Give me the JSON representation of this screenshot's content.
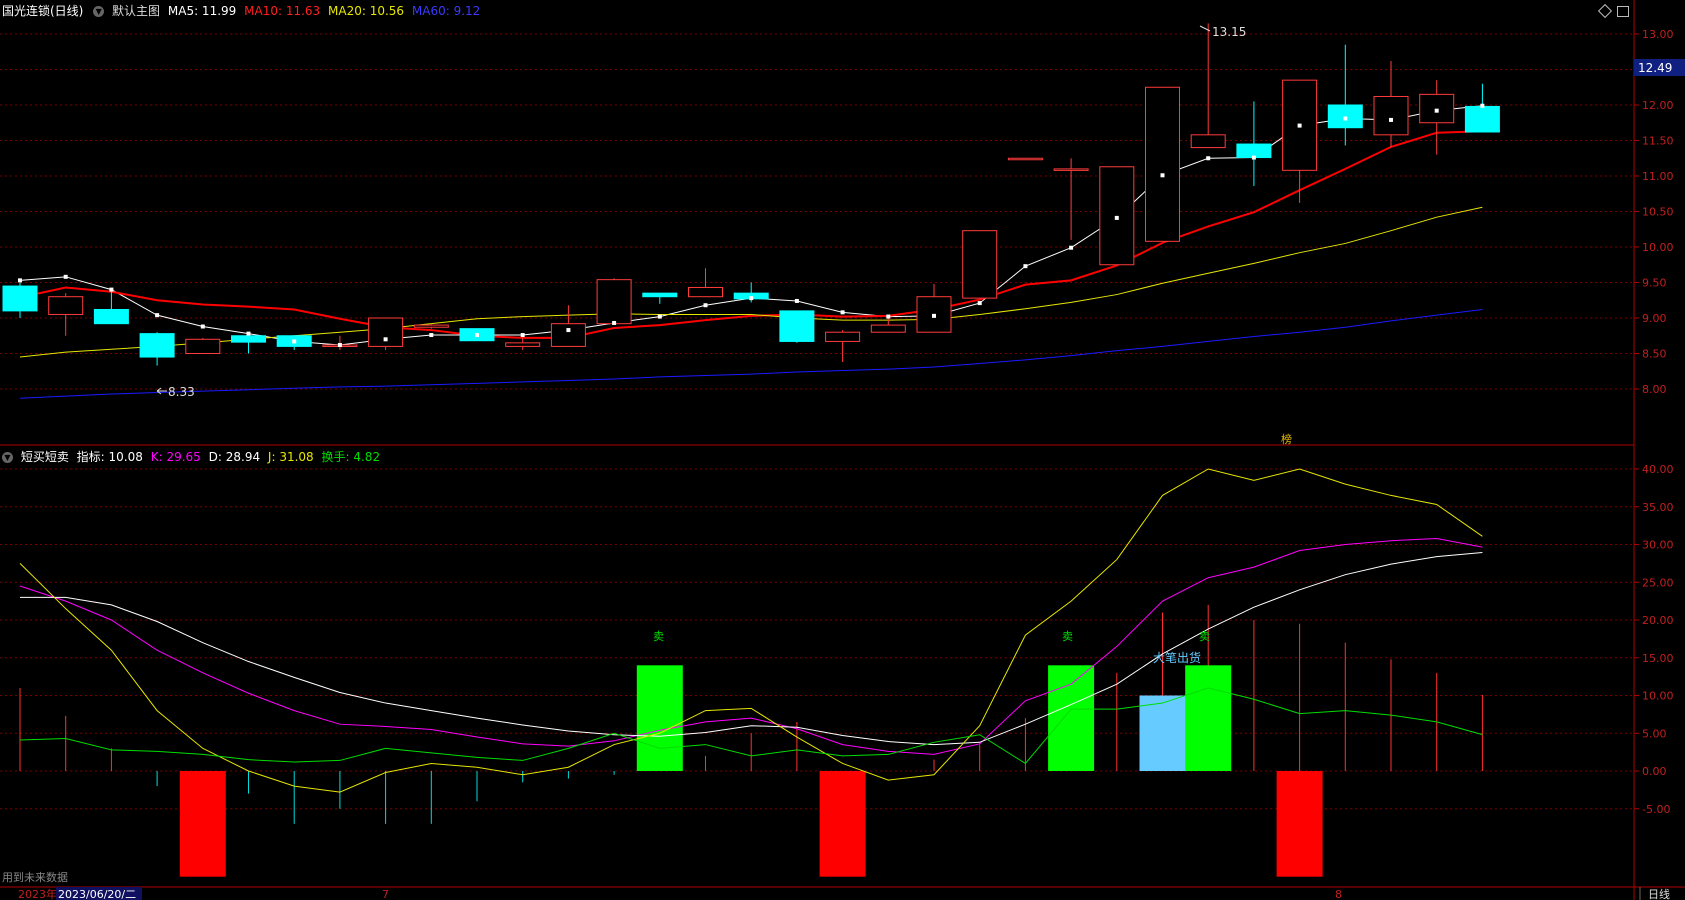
{
  "header": {
    "stock_title": "国光连锁(日线)",
    "main_chart_label": "默认主图",
    "ma5_label": "MA5: 11.99",
    "ma10_label": "MA10: 11.63",
    "ma20_label": "MA20: 10.56",
    "ma60_label": "MA60: 9.12"
  },
  "indicator_header": {
    "name": "短买短卖",
    "zhibiao_label": "指标: 10.08",
    "k_label": "K: 29.65",
    "d_label": "D: 28.94",
    "j_label": "J: 31.08",
    "turnover_label": "换手: 4.82"
  },
  "colors": {
    "up": "#ff3b3b",
    "down": "#00ffff",
    "ma5": "#ffffff",
    "ma10": "#ff0000",
    "ma20": "#e6e600",
    "ma60": "#1a1aff",
    "k": "#ff00ff",
    "d": "#ffffff",
    "j": "#e6e600",
    "turnover": "#00dd00",
    "grid": "#7a0000",
    "axis_text": "#c02020"
  },
  "price_axis": {
    "ticks": [
      "13.00",
      "12.50",
      "12.00",
      "11.50",
      "11.00",
      "10.50",
      "10.00",
      "9.50",
      "9.00",
      "8.50",
      "8.00"
    ],
    "current_price": "12.49",
    "high_label": "13.15",
    "low_label": "8.33"
  },
  "indicator_axis": {
    "ticks": [
      "40.00",
      "35.00",
      "30.00",
      "25.00",
      "20.00",
      "15.00",
      "10.00",
      "5.00",
      "0.00",
      "-5.00"
    ]
  },
  "annotations": {
    "sell_label": "卖",
    "big_order_label": "大笔出货",
    "bang_label": "榜"
  },
  "footer": {
    "future_data_note": "用到未来数据",
    "year_label": "2023年",
    "date_label": "2023/06/20/二",
    "month7": "7",
    "month8": "8",
    "period_button": "日线"
  },
  "icons": [
    "dropdown-icon",
    "diamond-icon",
    "window-icon",
    "high-arrow-icon",
    "low-arrow-icon"
  ],
  "chart_data": [
    {
      "type": "candlestick",
      "title": "国光连锁(日线)",
      "ylim": [
        7.8,
        13.3
      ],
      "candles": [
        {
          "o": 9.45,
          "h": 9.5,
          "l": 9.0,
          "c": 9.1
        },
        {
          "o": 9.05,
          "h": 9.35,
          "l": 8.75,
          "c": 9.3
        },
        {
          "o": 9.12,
          "h": 9.38,
          "l": 9.12,
          "c": 8.92
        },
        {
          "o": 8.78,
          "h": 8.8,
          "l": 8.33,
          "c": 8.45
        },
        {
          "o": 8.5,
          "h": 8.72,
          "l": 8.5,
          "c": 8.7
        },
        {
          "o": 8.75,
          "h": 8.78,
          "l": 8.5,
          "c": 8.66
        },
        {
          "o": 8.75,
          "h": 8.75,
          "l": 8.55,
          "c": 8.6
        },
        {
          "o": 8.62,
          "h": 8.75,
          "l": 8.55,
          "c": 8.62
        },
        {
          "o": 8.6,
          "h": 9.0,
          "l": 8.55,
          "c": 9.0
        },
        {
          "o": 8.87,
          "h": 8.92,
          "l": 8.85,
          "c": 8.9
        },
        {
          "o": 8.85,
          "h": 8.85,
          "l": 8.68,
          "c": 8.68
        },
        {
          "o": 8.6,
          "h": 8.72,
          "l": 8.55,
          "c": 8.65
        },
        {
          "o": 8.6,
          "h": 9.18,
          "l": 8.6,
          "c": 8.92
        },
        {
          "o": 8.92,
          "h": 9.56,
          "l": 8.92,
          "c": 9.54
        },
        {
          "o": 9.35,
          "h": 9.35,
          "l": 9.2,
          "c": 9.3
        },
        {
          "o": 9.3,
          "h": 9.7,
          "l": 9.3,
          "c": 9.43
        },
        {
          "o": 9.35,
          "h": 9.5,
          "l": 9.22,
          "c": 9.27
        },
        {
          "o": 9.1,
          "h": 9.1,
          "l": 8.65,
          "c": 8.67
        },
        {
          "o": 8.67,
          "h": 8.83,
          "l": 8.38,
          "c": 8.8
        },
        {
          "o": 8.8,
          "h": 9.05,
          "l": 8.8,
          "c": 8.9
        },
        {
          "o": 8.8,
          "h": 9.48,
          "l": 8.8,
          "c": 9.3
        },
        {
          "o": 9.28,
          "h": 10.23,
          "l": 9.28,
          "c": 10.23
        },
        {
          "o": 11.25,
          "h": 11.25,
          "l": 11.25,
          "c": 11.25
        },
        {
          "o": 11.1,
          "h": 11.25,
          "l": 10.1,
          "c": 11.1
        },
        {
          "o": 9.75,
          "h": 11.13,
          "l": 9.75,
          "c": 11.13
        },
        {
          "o": 10.08,
          "h": 12.25,
          "l": 10.08,
          "c": 12.25
        },
        {
          "o": 11.4,
          "h": 13.15,
          "l": 11.4,
          "c": 11.58
        },
        {
          "o": 11.45,
          "h": 12.05,
          "l": 10.86,
          "c": 11.26
        },
        {
          "o": 11.08,
          "h": 12.35,
          "l": 10.62,
          "c": 12.35
        },
        {
          "o": 12.0,
          "h": 12.85,
          "l": 11.43,
          "c": 11.68
        },
        {
          "o": 11.58,
          "h": 12.62,
          "l": 11.4,
          "c": 12.12
        },
        {
          "o": 11.75,
          "h": 12.35,
          "l": 11.3,
          "c": 12.15
        },
        {
          "o": 11.98,
          "h": 12.3,
          "l": 11.62,
          "c": 11.62
        }
      ],
      "series": [
        {
          "name": "MA5",
          "values": [
            9.53,
            9.58,
            9.4,
            9.04,
            8.88,
            8.78,
            8.67,
            8.62,
            8.7,
            8.76,
            8.76,
            8.76,
            8.83,
            8.93,
            9.02,
            9.18,
            9.28,
            9.24,
            9.08,
            9.02,
            9.03,
            9.21,
            9.73,
            9.99,
            10.41,
            11.01,
            11.25,
            11.26,
            11.71,
            11.81,
            11.79,
            11.92,
            11.99
          ]
        },
        {
          "name": "MA10",
          "values": [
            9.29,
            9.43,
            9.37,
            9.25,
            9.19,
            9.16,
            9.12,
            8.99,
            8.87,
            8.83,
            8.75,
            8.72,
            8.72,
            8.86,
            8.9,
            8.97,
            9.03,
            9.05,
            9.02,
            9.03,
            9.12,
            9.26,
            9.47,
            9.53,
            9.74,
            10.06,
            10.29,
            10.49,
            10.8,
            11.1,
            11.41,
            11.61,
            11.63
          ]
        },
        {
          "name": "MA20",
          "values": [
            8.45,
            8.52,
            8.56,
            8.6,
            8.65,
            8.7,
            8.75,
            8.8,
            8.85,
            8.92,
            8.99,
            9.02,
            9.04,
            9.06,
            9.05,
            9.05,
            9.05,
            9.0,
            8.97,
            8.97,
            8.98,
            9.05,
            9.13,
            9.22,
            9.33,
            9.49,
            9.63,
            9.77,
            9.92,
            10.05,
            10.23,
            10.42,
            10.56
          ]
        },
        {
          "name": "MA60",
          "values": [
            7.87,
            7.9,
            7.93,
            7.95,
            7.97,
            7.99,
            8.01,
            8.03,
            8.04,
            8.06,
            8.08,
            8.1,
            8.12,
            8.14,
            8.17,
            8.19,
            8.21,
            8.24,
            8.26,
            8.28,
            8.31,
            8.36,
            8.41,
            8.47,
            8.54,
            8.6,
            8.67,
            8.74,
            8.8,
            8.87,
            8.96,
            9.04,
            9.12
          ]
        }
      ]
    },
    {
      "type": "line",
      "title": "短买短卖",
      "ylim": [
        -14,
        42
      ],
      "series": [
        {
          "name": "K",
          "values": [
            24.5,
            22.5,
            20,
            16,
            13,
            10.3,
            8,
            6.2,
            5.9,
            5.5,
            4.5,
            3.6,
            3.3,
            4,
            5.4,
            6.5,
            7,
            5.6,
            3.5,
            2.6,
            2.2,
            3.6,
            9.3,
            11.5,
            16.5,
            22.5,
            25.6,
            27,
            29.2,
            30,
            30.5,
            30.8,
            29.65
          ]
        },
        {
          "name": "D",
          "values": [
            23,
            23,
            22,
            19.8,
            17,
            14.5,
            12.4,
            10.4,
            9,
            8,
            7,
            6.1,
            5.3,
            4.8,
            4.6,
            5.1,
            6,
            5.8,
            4.7,
            3.9,
            3.5,
            3.8,
            6.2,
            8.8,
            11.5,
            15.5,
            18.8,
            21.7,
            24,
            26,
            27.4,
            28.4,
            28.94
          ]
        },
        {
          "name": "J",
          "values": [
            27.5,
            21.5,
            16,
            8,
            3,
            0,
            -2,
            -2.8,
            -0.2,
            1,
            0.5,
            -0.5,
            0.5,
            3.5,
            5,
            8,
            8.3,
            4.5,
            1,
            -1.2,
            -0.5,
            6,
            18,
            22.5,
            28,
            36.5,
            40,
            38.5,
            40,
            38,
            36.5,
            35.3,
            31.08
          ]
        },
        {
          "name": "换手",
          "values": [
            4.1,
            4.3,
            2.8,
            2.6,
            2.2,
            1.5,
            1.2,
            1.4,
            3,
            2.4,
            1.8,
            1.4,
            3,
            5,
            3,
            3.5,
            2,
            2.8,
            2,
            2.2,
            3.8,
            4.8,
            1,
            8.2,
            8.2,
            9,
            11,
            9.5,
            7.6,
            8,
            7.4,
            6.5,
            4.82
          ]
        },
        {
          "name": "指标",
          "values": [
            11,
            7.3,
            3,
            -2,
            -1,
            -3,
            -7,
            -5,
            -7,
            -7,
            -4,
            -1.5,
            -1,
            -0.5,
            0.8,
            2,
            5,
            6.5,
            -0.5,
            0,
            1.5,
            3.5,
            7,
            11,
            13,
            21,
            22,
            20,
            19.5,
            17,
            14.8,
            13,
            10.08
          ]
        }
      ],
      "signal_bars": [
        {
          "index": 4,
          "value": -14,
          "type": "buy"
        },
        {
          "index": 14,
          "value": 14,
          "type": "sell"
        },
        {
          "index": 18,
          "value": -14,
          "type": "buy"
        },
        {
          "index": 23,
          "value": 14,
          "type": "sell"
        },
        {
          "index": 25,
          "value": 10,
          "type": "big_order"
        },
        {
          "index": 26,
          "value": 14,
          "type": "sell"
        },
        {
          "index": 28,
          "value": -14,
          "type": "buy"
        }
      ]
    }
  ]
}
